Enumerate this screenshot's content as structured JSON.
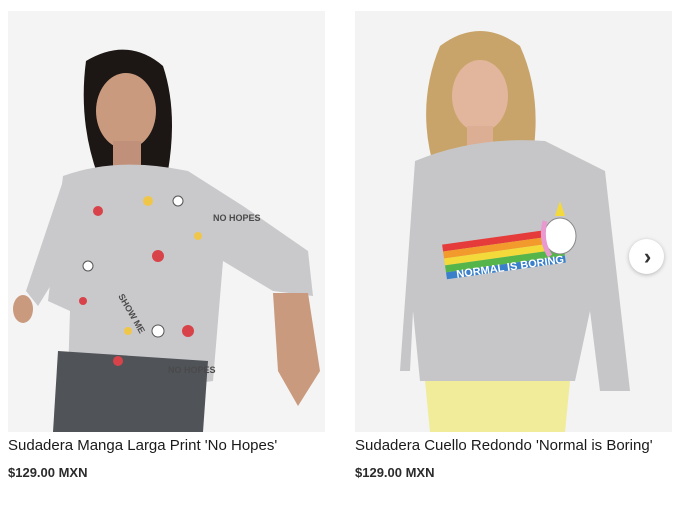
{
  "products": [
    {
      "title": "Sudadera Manga Larga Print 'No Hopes'",
      "price": "$129.00 MXN",
      "print_texts": [
        "NO HOPES",
        "SHOW ME",
        "NO HOPES"
      ]
    },
    {
      "title": "Sudadera Cuello Redondo 'Normal is Boring'",
      "price": "$129.00 MXN",
      "print_text": "NORMAL IS BORING"
    }
  ],
  "carousel": {
    "next_icon": "›"
  },
  "colors": {
    "background": "#ffffff",
    "photo_bg": "#f2f2f2",
    "sweater_gray": "#c9c9cc",
    "text": "#1a1a1a"
  }
}
